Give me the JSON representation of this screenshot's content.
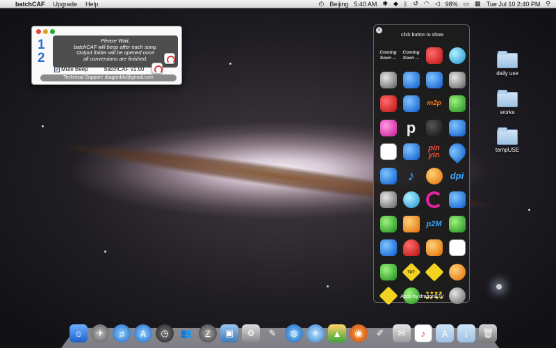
{
  "menubar": {
    "apple": "",
    "app_name": "batchCAF",
    "menus": [
      "Upgrade",
      "Help"
    ],
    "location": "Beijing",
    "time_local": "5:40 AM",
    "battery": "98%",
    "datetime": "Tue Jul 10  2:40 PM"
  },
  "batchcaf_window": {
    "digits": [
      "1",
      "2"
    ],
    "message": [
      "Please Wait,",
      "batchCAF will beep after each song.",
      "Output folder will be opened once",
      "all conversions are finished."
    ],
    "mute_label": "Mute Beep",
    "mute_checked": true,
    "version": "batchCAF v1.50",
    "support": "Technical Support:  dragonbtv@gmail.com"
  },
  "launcher": {
    "close_glyph": "×",
    "header": "click button to show",
    "coming_soon": "Coming Soon ...",
    "labels": {
      "m2p": "m2p",
      "p": "p",
      "pinyin": [
        "pin",
        "yin"
      ],
      "dpi": "dpi",
      "p2m": "p2M",
      "txt": "TXT",
      "stars": "★★★★ ★★ ★★"
    },
    "footer": "Apps by dragonBTV"
  },
  "desktop_folders": [
    "daily use",
    "works",
    "tempUSE"
  ]
}
